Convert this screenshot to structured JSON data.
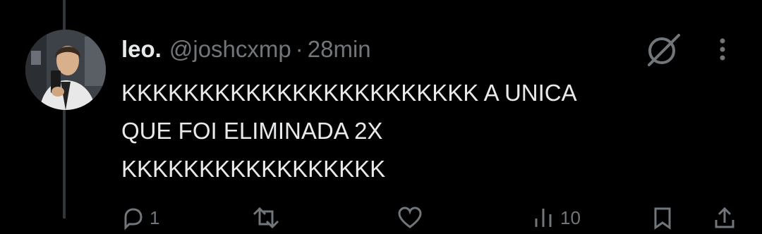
{
  "tweet": {
    "author_name": "leo.",
    "handle": "@joshcxmp",
    "separator": "·",
    "time": "28min",
    "text": "KKKKKKKKKKKKKKKKKKKKKKK A UNICA\nQUE FOI ELIMINADA 2X\nKKKKKKKKKKKKKKKKK"
  },
  "header_icons": [
    "grok-icon",
    "more-icon"
  ],
  "actions": {
    "reply": {
      "icon": "reply-icon",
      "count": "1"
    },
    "retweet": {
      "icon": "retweet-icon"
    },
    "like": {
      "icon": "heart-icon"
    },
    "views": {
      "icon": "views-icon",
      "count": "10"
    },
    "bookmark": {
      "icon": "bookmark-icon"
    },
    "share": {
      "icon": "share-icon"
    }
  },
  "colors": {
    "background": "#000000",
    "primary_text": "#e7e9ea",
    "secondary_text": "#71767b",
    "thread_line": "#333639"
  }
}
